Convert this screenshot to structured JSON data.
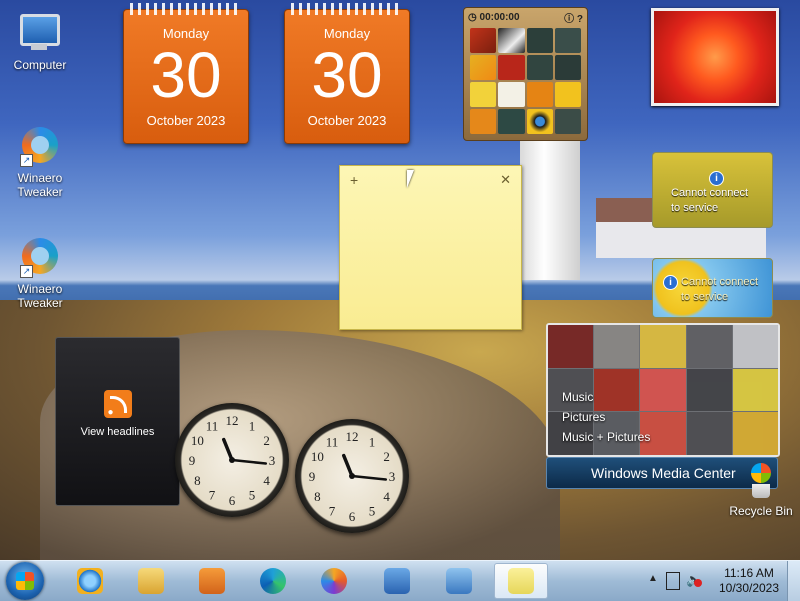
{
  "desktop_icons": [
    {
      "label": "Computer"
    },
    {
      "label": "Winaero\nTweaker"
    },
    {
      "label": "Winaero\nTweaker"
    }
  ],
  "calendars": [
    {
      "day_of_week": "Monday",
      "day": "30",
      "month_year": "October 2023"
    },
    {
      "day_of_week": "Monday",
      "day": "30",
      "month_year": "October 2023"
    }
  ],
  "puzzle": {
    "timer": "00:00:00",
    "help": "?"
  },
  "weather": [
    {
      "message": "Cannot connect\nto service"
    },
    {
      "message": "Cannot connect\nto service"
    }
  ],
  "feed": {
    "label": "View headlines"
  },
  "clocks": [
    {
      "hour": 11,
      "minute": 16
    },
    {
      "hour": 11,
      "minute": 16
    }
  ],
  "media_center": {
    "menu": [
      "Music",
      "Pictures",
      "Music + Pictures"
    ],
    "bar_label": "Windows Media Center"
  },
  "recycle_bin": {
    "label": "Recycle Bin"
  },
  "taskbar": {
    "apps": [
      "internet-explorer",
      "file-explorer",
      "media-player",
      "edge",
      "firefox",
      "remote-desktop",
      "control-panel",
      "sticky-notes"
    ],
    "time": "11:16 AM",
    "date": "10/30/2023"
  }
}
